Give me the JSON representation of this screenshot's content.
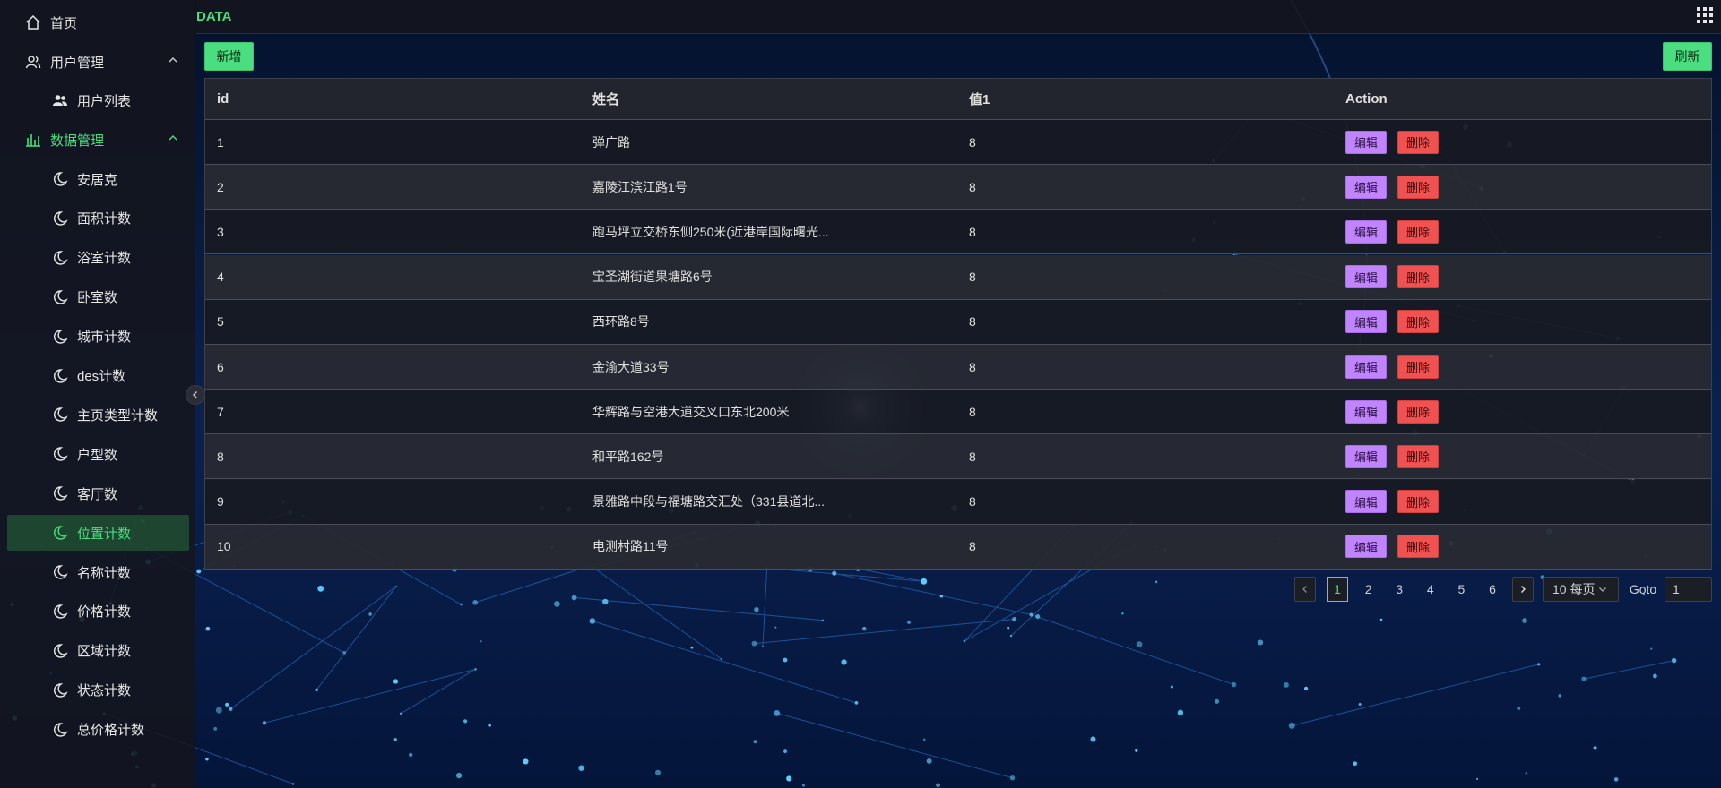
{
  "header": {
    "title": "DATA"
  },
  "sidebar": {
    "home": "首页",
    "user_group": "用户管理",
    "user_list": "用户列表",
    "data_group": "数据管理",
    "data_items": [
      "安居克",
      "面积计数",
      "浴室计数",
      "卧室数",
      "城市计数",
      "des计数",
      "主页类型计数",
      "户型数",
      "客厅数",
      "位置计数",
      "名称计数",
      "价格计数",
      "区域计数",
      "状态计数",
      "总价格计数"
    ],
    "active_index": 9
  },
  "toolbar": {
    "add_label": "新增",
    "refresh_label": "刷新"
  },
  "table": {
    "columns": [
      "id",
      "姓名",
      "值1",
      "Action"
    ],
    "rows": [
      {
        "id": "1",
        "name": "弹广路",
        "value": "8"
      },
      {
        "id": "2",
        "name": "嘉陵江滨江路1号",
        "value": "8"
      },
      {
        "id": "3",
        "name": "跑马坪立交桥东侧250米(近港岸国际曙光...",
        "value": "8"
      },
      {
        "id": "4",
        "name": "宝圣湖街道果塘路6号",
        "value": "8"
      },
      {
        "id": "5",
        "name": "西环路8号",
        "value": "8"
      },
      {
        "id": "6",
        "name": "金渝大道33号",
        "value": "8"
      },
      {
        "id": "7",
        "name": "华辉路与空港大道交叉口东北200米",
        "value": "8"
      },
      {
        "id": "8",
        "name": "和平路162号",
        "value": "8"
      },
      {
        "id": "9",
        "name": "景雅路中段与福塘路交汇处（331县道北...",
        "value": "8"
      },
      {
        "id": "10",
        "name": "电测村路11号",
        "value": "8"
      }
    ],
    "edit_label": "编辑",
    "delete_label": "删除"
  },
  "pagination": {
    "pages": [
      "1",
      "2",
      "3",
      "4",
      "5",
      "6"
    ],
    "current": "1",
    "page_size": "10 每页",
    "goto_label": "Goto",
    "goto_value": "1"
  },
  "colors": {
    "accent": "#4ade80",
    "edit": "#c084fc",
    "delete": "#f05252",
    "background": "#05122a"
  }
}
